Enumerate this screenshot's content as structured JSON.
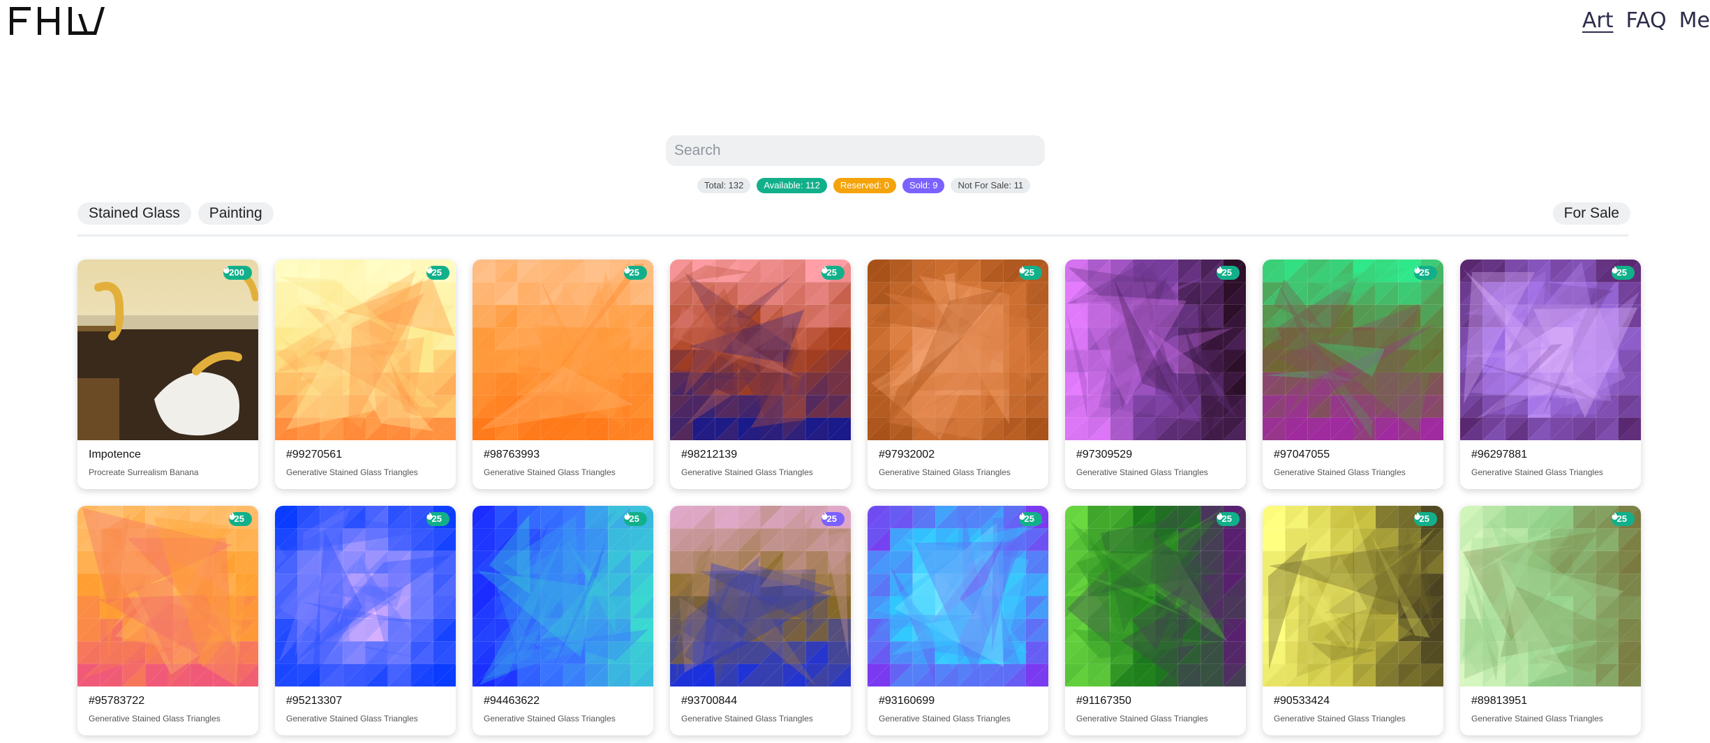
{
  "header": {
    "logo_text": "FHW",
    "nav": [
      {
        "label": "Art",
        "active": true
      },
      {
        "label": "FAQ",
        "active": false
      },
      {
        "label": "Me",
        "active": false
      }
    ]
  },
  "search": {
    "placeholder": "Search",
    "value": ""
  },
  "stats": {
    "total": "Total: 132",
    "available": "Available: 112",
    "reserved": "Reserved: 0",
    "sold": "Sold: 9",
    "not_for_sale": "Not For Sale: 11"
  },
  "filters": {
    "categories": [
      "Stained Glass",
      "Painting"
    ],
    "for_sale": "For Sale"
  },
  "colors": {
    "available": "#12b08a",
    "reserved": "#f5a30b",
    "sold": "#7b61ff",
    "neutral": "#e9ecef"
  },
  "items": [
    {
      "title": "Impotence",
      "subtitle": "Procreate Surrealism Banana",
      "price": "200",
      "icon": "fire-icon",
      "status_color": "#12b08a",
      "art": "painting"
    },
    {
      "title": "#99270561",
      "subtitle": "Generative Stained Glass Triangles",
      "price": "25",
      "icon": "fire-icon",
      "status_color": "#12b08a",
      "colors": [
        "#fffcc4",
        "#fde98c",
        "#ff8a3a"
      ]
    },
    {
      "title": "#98763993",
      "subtitle": "Generative Stained Glass Triangles",
      "price": "25",
      "icon": "fire-icon",
      "status_color": "#12b08a",
      "colors": [
        "#ffc08a",
        "#ff9a3c",
        "#ff7a1a"
      ]
    },
    {
      "title": "#98212139",
      "subtitle": "Generative Stained Glass Triangles",
      "price": "25",
      "icon": "fire-icon",
      "status_color": "#12b08a",
      "colors": [
        "#ff9ea6",
        "#a8401c",
        "#1a1a8a"
      ]
    },
    {
      "title": "#97932002",
      "subtitle": "Generative Stained Glass Triangles",
      "price": "25",
      "icon": "fire-icon",
      "status_color": "#12b08a",
      "colors": [
        "#ffb38a",
        "#d87838",
        "#a8521a"
      ]
    },
    {
      "title": "#97309529",
      "subtitle": "Generative Stained Glass Triangles",
      "price": "25",
      "icon": "fire-icon",
      "status_color": "#12b08a",
      "colors": [
        "#e67cff",
        "#7a3fa0",
        "#2d0f2a"
      ]
    },
    {
      "title": "#97047055",
      "subtitle": "Generative Stained Glass Triangles",
      "price": "25",
      "icon": "fire-icon",
      "status_color": "#12b08a",
      "colors": [
        "#2ee88a",
        "#6e6a30",
        "#a02aa0"
      ]
    },
    {
      "title": "#96297881",
      "subtitle": "Generative Stained Glass Triangles",
      "price": "25",
      "icon": "fire-icon",
      "status_color": "#12b08a",
      "colors": [
        "#f0c4ff",
        "#a070e8",
        "#5a2870"
      ]
    },
    {
      "title": "#95783722",
      "subtitle": "Generative Stained Glass Triangles",
      "price": "25",
      "icon": "fire-icon",
      "status_color": "#12b08a",
      "colors": [
        "#ffc070",
        "#ffa030",
        "#f05a78"
      ]
    },
    {
      "title": "#95213307",
      "subtitle": "Generative Stained Glass Triangles",
      "price": "25",
      "icon": "fire-icon",
      "status_color": "#12b08a",
      "colors": [
        "#ffc4ff",
        "#6f7cff",
        "#0a3cff"
      ]
    },
    {
      "title": "#94463622",
      "subtitle": "Generative Stained Glass Triangles",
      "price": "25",
      "icon": "fire-icon",
      "status_color": "#12b08a",
      "colors": [
        "#1a2cff",
        "#3a78ff",
        "#3ad8d0"
      ]
    },
    {
      "title": "#93700844",
      "subtitle": "Generative Stained Glass Triangles",
      "price": "25",
      "icon": "fire-icon",
      "status_color": "#7b61ff",
      "colors": [
        "#e0a8c8",
        "#8a6a20",
        "#1a30e0"
      ]
    },
    {
      "title": "#93160699",
      "subtitle": "Generative Stained Glass Triangles",
      "price": "25",
      "icon": "fire-icon",
      "status_color": "#12b08a",
      "colors": [
        "#9af8ff",
        "#2ec8ff",
        "#7a3af0"
      ]
    },
    {
      "title": "#91167350",
      "subtitle": "Generative Stained Glass Triangles",
      "price": "25",
      "icon": "fire-icon",
      "status_color": "#12b08a",
      "colors": [
        "#6ad840",
        "#1a7a1a",
        "#5a2070"
      ]
    },
    {
      "title": "#90533424",
      "subtitle": "Generative Stained Glass Triangles",
      "price": "25",
      "icon": "fire-icon",
      "status_color": "#12b08a",
      "colors": [
        "#ffff80",
        "#c8c040",
        "#4a4220"
      ]
    },
    {
      "title": "#89813951",
      "subtitle": "Generative Stained Glass Triangles",
      "price": "25",
      "icon": "fire-icon",
      "status_color": "#12b08a",
      "colors": [
        "#d8f8c0",
        "#90d088",
        "#7a7a40"
      ]
    }
  ]
}
